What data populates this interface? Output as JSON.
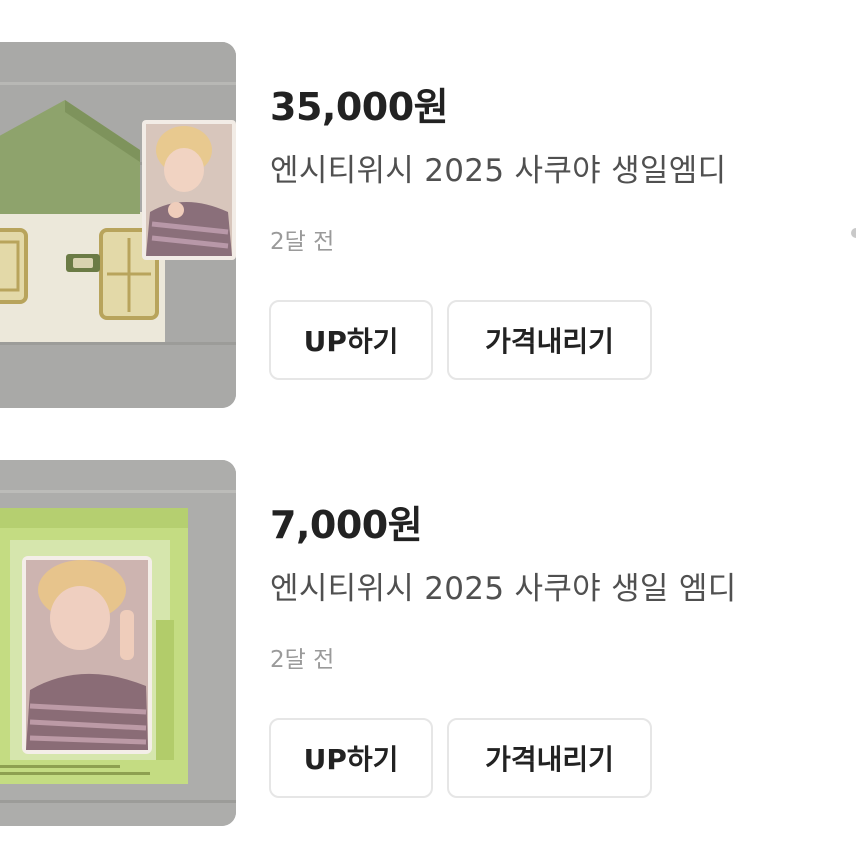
{
  "items": [
    {
      "price": "35,000원",
      "title": "엔시티위시 2025 사쿠야 생일엠디",
      "time": "2달 전",
      "buttons": {
        "up": "UP하기",
        "lower_price": "가격내리기"
      },
      "thumbnail_icon": "product-photo-pouch"
    },
    {
      "price": "7,000원",
      "title": "엔시티위시 2025 사쿠야 생일 엠디",
      "time": "2달 전",
      "buttons": {
        "up": "UP하기",
        "lower_price": "가격내리기"
      },
      "thumbnail_icon": "product-photo-card"
    }
  ],
  "colors": {
    "price_text": "#222222",
    "title_text": "#505050",
    "time_text": "#9a9a9a",
    "button_border": "#e6e6e6",
    "pouch_green": "#8ea36c",
    "card_lime": "#c4dc82"
  }
}
